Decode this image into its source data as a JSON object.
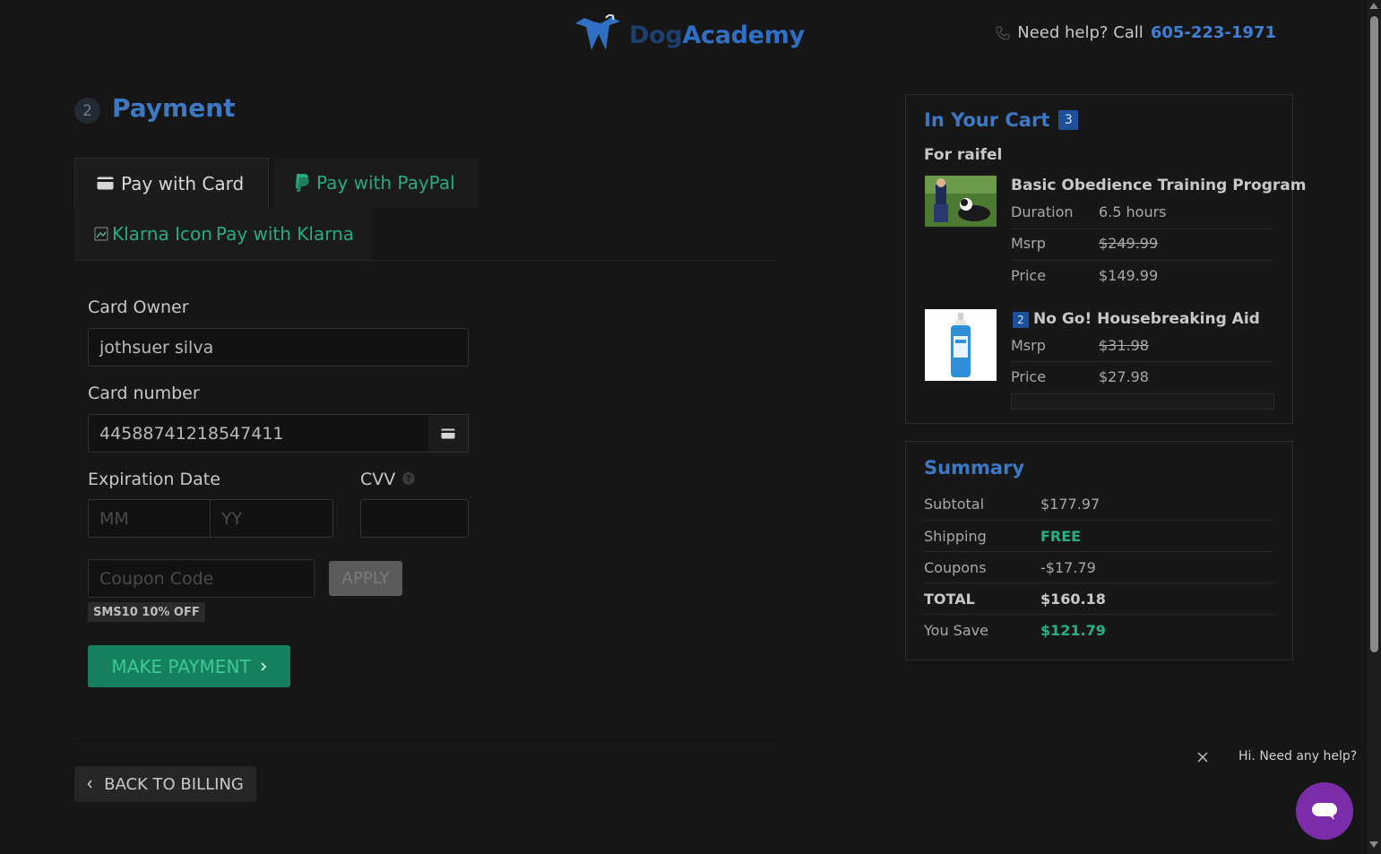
{
  "header": {
    "logo_part1": "Dog",
    "logo_part2": "Academy",
    "help_text": "Need help? Call",
    "help_phone": "605-223-1971"
  },
  "payment": {
    "step_number": "2",
    "title": "Payment",
    "tabs": {
      "card": "Pay with Card",
      "paypal": "Pay with PayPal",
      "klarna_alt": "Klarna Icon",
      "klarna": "Pay with Klarna"
    },
    "form": {
      "card_owner_label": "Card Owner",
      "card_owner_value": "jothsuer silva",
      "card_number_label": "Card number",
      "card_number_value": "445887412185474​11",
      "expiration_label": "Expiration Date",
      "mm_placeholder": "MM",
      "yy_placeholder": "YY",
      "cvv_label": "CVV",
      "cvv_help": "?",
      "coupon_placeholder": "Coupon Code",
      "apply_label": "APPLY",
      "coupon_badge": "SMS10 10% OFF",
      "make_payment_label": "MAKE PAYMENT"
    },
    "back_label": "BACK TO BILLING"
  },
  "cart": {
    "title": "In Your Cart",
    "count": "3",
    "for_label": "For raifel",
    "items": [
      {
        "name": "Basic Obedience Training Program",
        "rows": [
          {
            "key": "Duration",
            "value": "6.5 hours"
          },
          {
            "key": "Msrp",
            "value": "$249.99"
          },
          {
            "key": "Price",
            "value": "$149.99"
          }
        ]
      },
      {
        "qty": "2",
        "name": "No Go! Housebreaking Aid",
        "rows": [
          {
            "key": "Msrp",
            "value": "$31.98"
          },
          {
            "key": "Price",
            "value": "$27.98"
          }
        ]
      }
    ]
  },
  "summary": {
    "title": "Summary",
    "rows": [
      {
        "key": "Subtotal",
        "value": "$177.97"
      },
      {
        "key": "Shipping",
        "value": "FREE"
      },
      {
        "key": "Coupons",
        "value": "-$17.79"
      },
      {
        "key": "TOTAL",
        "value": "$160.18"
      },
      {
        "key": "You Save",
        "value": "$121.79"
      }
    ]
  },
  "chat": {
    "message": "Hi. Need any help?"
  },
  "colors": {
    "accent_blue": "#3e78c2",
    "accent_green": "#27b082",
    "chat_purple": "#7b2ca8"
  }
}
